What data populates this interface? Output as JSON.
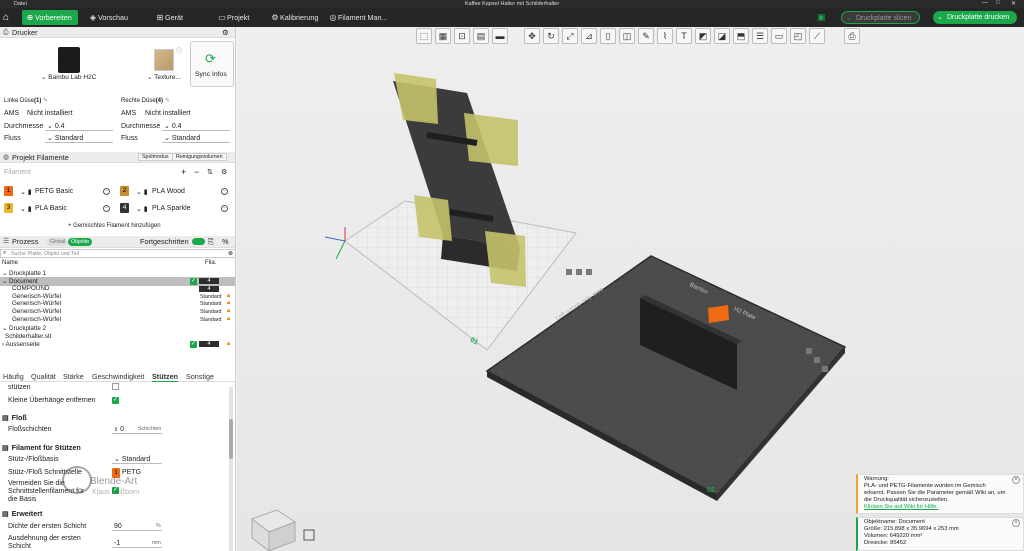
{
  "window": {
    "title": "Kaffee Kapsel Halter mit Schilderhalter",
    "menu_label": "Datei",
    "min": "—",
    "max": "□",
    "close": "✕"
  },
  "topbar": {
    "home_icon": "⌂",
    "tabs": [
      {
        "label": "Vorbereiten",
        "icon": "⊕"
      },
      {
        "label": "Vorschau",
        "icon": "◈"
      },
      {
        "label": "Gerät",
        "icon": "⊞"
      },
      {
        "label": "Projekt",
        "icon": "▭"
      },
      {
        "label": "Kalibrierung",
        "icon": "⚙"
      },
      {
        "label": "Filament Man...",
        "icon": "◎"
      }
    ],
    "slice_button": "Druckplatte slicen",
    "print_button": "Druckplatte drucken",
    "accent": "#1aa84a"
  },
  "printer": {
    "section": "Drucker",
    "name": "Bambu Lab H2C",
    "plate": "Texture...",
    "sync": "Sync Infos",
    "left_nozzle": "Linke Düse",
    "left_nozzle_num": "(1)",
    "right_nozzle": "Rechte Düse",
    "right_nozzle_num": "(4)",
    "ams_label": "AMS",
    "ams_left": "Nicht installiert",
    "ams_right": "Nicht installiert",
    "diameter_label": "Durchmesser",
    "diameter_left": "0.4",
    "diameter_right": "0.4",
    "flow_label": "Fluss",
    "flow_left": "Standard",
    "flow_right": "Standard"
  },
  "filaments": {
    "section": "Projekt Filamente",
    "btn_flush": "Spülmodus",
    "btn_clean": "Reinigungsvolumen",
    "placeholder": "Filament",
    "items": [
      {
        "num": "1",
        "name": "PETG Basic",
        "color": "#ef6a13"
      },
      {
        "num": "2",
        "name": "PLA Wood",
        "color": "#c68d2e"
      },
      {
        "num": "3",
        "name": "PLA Basic",
        "color": "#e9b52b"
      },
      {
        "num": "4",
        "name": "PLA Sparkle",
        "color": "#333333"
      }
    ],
    "add_mixed": "+ Gemischtes Filament hinzufügen"
  },
  "process": {
    "section": "Prozess",
    "toggle_global": "Global",
    "toggle_object": "Objekte",
    "advanced": "Fortgeschritten",
    "search_placeholder": "Suche Platte, Objekt und Teil",
    "col_name": "Name",
    "col_fila": "Fila.",
    "tree": [
      {
        "label": "⌄ Druckplatte 1",
        "indent": 0
      },
      {
        "label": "⌄ Document",
        "indent": 0
      },
      {
        "label": "COMPOUND",
        "indent": 1
      },
      {
        "label": "Generisch-Würfel",
        "indent": 1
      },
      {
        "label": "Generisch-Würfel",
        "indent": 1
      },
      {
        "label": "Generisch-Würfel",
        "indent": 1
      },
      {
        "label": "Generisch-Würfel",
        "indent": 1
      },
      {
        "label": "⌄ Druckplatte 2",
        "indent": 0
      },
      {
        "label": "Schilderhalter.stl",
        "indent": 1
      },
      {
        "label": "› Aussenseite",
        "indent": 0
      }
    ],
    "tree_fila": [
      "",
      "4",
      "4",
      "Standard",
      "Standard",
      "Standard",
      "Standard",
      "",
      "4",
      ""
    ]
  },
  "settings_tabs": [
    "Häufig",
    "Qualität",
    "Stärke",
    "Geschwindigkeit",
    "Stützen",
    "Sonstige"
  ],
  "settings": {
    "supports_label": "stützen",
    "small_overhang": "Kleine Überhänge entfernen",
    "raft_header": "Floß",
    "raft_layers": "Floßschichten",
    "raft_value": "0",
    "raft_unit": "Schichten",
    "support_fil_header": "Filament für Stützen",
    "support_base": "Stütz-/Floßbasis",
    "support_base_value": "Standard",
    "support_iface": "Stütz-/Floß Schnittstelle",
    "support_iface_value": "PETG",
    "avoid_line1": "Vermeiden Sie die",
    "avoid_line2": "Schnittstellenfilament für",
    "avoid_line3": "die Basis",
    "extended_header": "Erweitert",
    "first_density": "Dichte der ersten Schicht",
    "first_density_value": "90",
    "first_density_unit": "%",
    "first_expand_1": "Ausdehnung der ersten",
    "first_expand_2": "Schicht",
    "first_expand_value": "-1",
    "first_expand_unit": "mm",
    "watermark_1": "Blende-Art",
    "watermark_2": "Klaus Leißborn"
  },
  "plates": {
    "plate1": "01",
    "plate2": "02",
    "bed_label": "Left nozzle only area",
    "bed_label_right": "H2 Plate",
    "bed_label_top": "Bambu"
  },
  "notifications": {
    "warning_lines": [
      "Warnung:",
      "PLA- und PETG-Filamente wurden im Gemisch",
      "erkannt. Passen Sie die Parameter gemäß Wiki an, um",
      "die Druckqualität sicherzustellen."
    ],
    "warning_link": "Klicken Sie auf Wiki für Hilfe.",
    "warning_color": "#f0a030",
    "info_lines": [
      "Objektname: Document",
      "Größe: 215.898 x 35.9694 x 253 mm",
      "Volumen: 649220 mm³",
      "Dreiecke: 85452"
    ],
    "info_color": "#1aa84a"
  }
}
